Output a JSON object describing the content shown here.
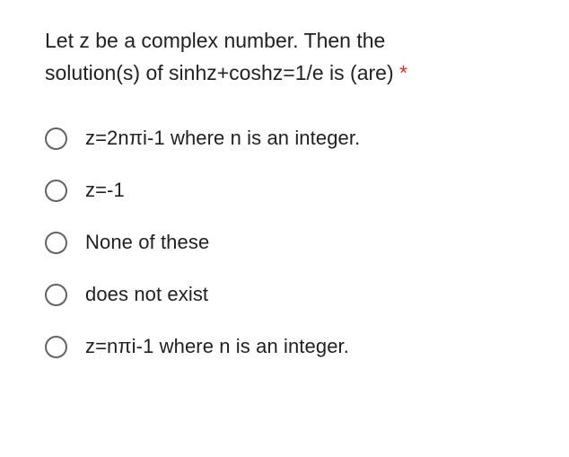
{
  "question": {
    "line1": "Let z be a complex number. Then the",
    "line2": "solution(s) of sinhz+coshz=1/e is (are)",
    "required_marker": "*"
  },
  "options": [
    {
      "label": "z=2nπi-1 where n is an integer."
    },
    {
      "label": "z=-1"
    },
    {
      "label": "None of these"
    },
    {
      "label": "does not exist"
    },
    {
      "label": "z=nπi-1 where n is an integer."
    }
  ]
}
